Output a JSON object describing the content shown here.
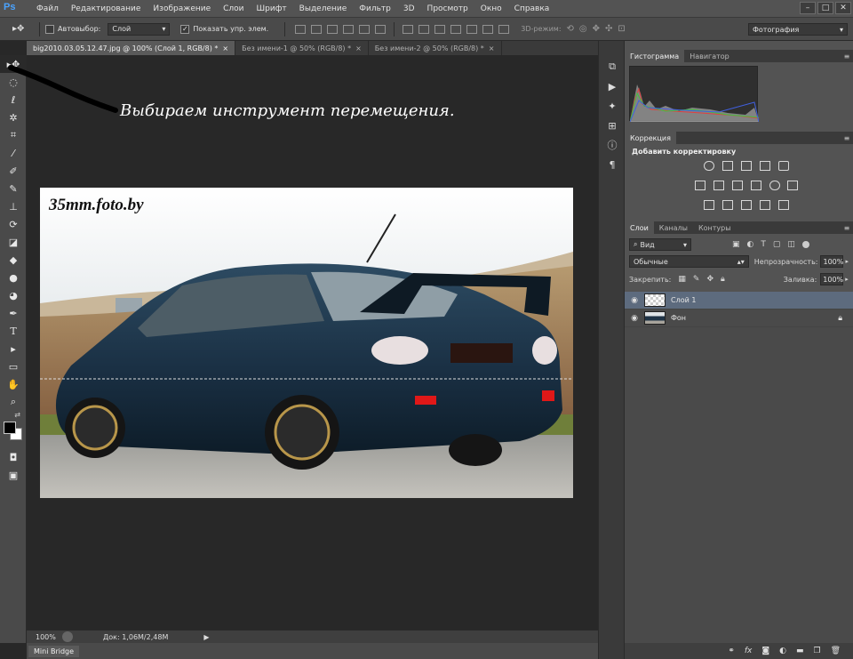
{
  "app": {
    "logo": "Ps",
    "menu": [
      "Файл",
      "Редактирование",
      "Изображение",
      "Слои",
      "Шрифт",
      "Выделение",
      "Фильтр",
      "3D",
      "Просмотр",
      "Окно",
      "Справка"
    ],
    "window_controls": [
      "–",
      "□",
      "✕"
    ]
  },
  "options": {
    "autoselect_label": "Автовыбор:",
    "autoselect_value": "Слой",
    "show_controls_label": "Показать упр. элем.",
    "mode_3d_label": "3D-режим:",
    "workspace": "Фотография"
  },
  "tabs": [
    {
      "label": "big2010.03.05.12.47.jpg @ 100% (Слой 1, RGB/8) *",
      "active": true
    },
    {
      "label": "Без имени-1 @ 50% (RGB/8) *",
      "active": false
    },
    {
      "label": "Без имени-2 @ 50% (RGB/8) *",
      "active": false
    }
  ],
  "tab_close": "×",
  "canvas": {
    "instruction": "Выбираем инструмент перемещения.",
    "watermark": "35mm.foto.by"
  },
  "status": {
    "zoom": "100%",
    "doc_info": "Док: 1,06M/2,48M"
  },
  "mini_bridge": "Mini Bridge",
  "panels": {
    "histogram_tab": "Гистограмма",
    "navigator_tab": "Навигатор",
    "correction_tab": "Коррекция",
    "add_adjustment": "Добавить корректировку",
    "layers_tabs": [
      "Слои",
      "Каналы",
      "Контуры"
    ],
    "filter_kind": "Вид",
    "blend_mode": "Обычные",
    "opacity_label": "Непрозрачность:",
    "opacity_value": "100%",
    "lock_label": "Закрепить:",
    "fill_label": "Заливка:",
    "fill_value": "100%",
    "layers": [
      {
        "name": "Слой 1",
        "selected": true,
        "locked": false
      },
      {
        "name": "Фон",
        "selected": false,
        "locked": true
      }
    ]
  },
  "colors": {
    "accent": "#4aa3ff",
    "panel_bg": "#535353",
    "canvas_bg": "#282828",
    "selected_layer": "#5d6b7e"
  }
}
